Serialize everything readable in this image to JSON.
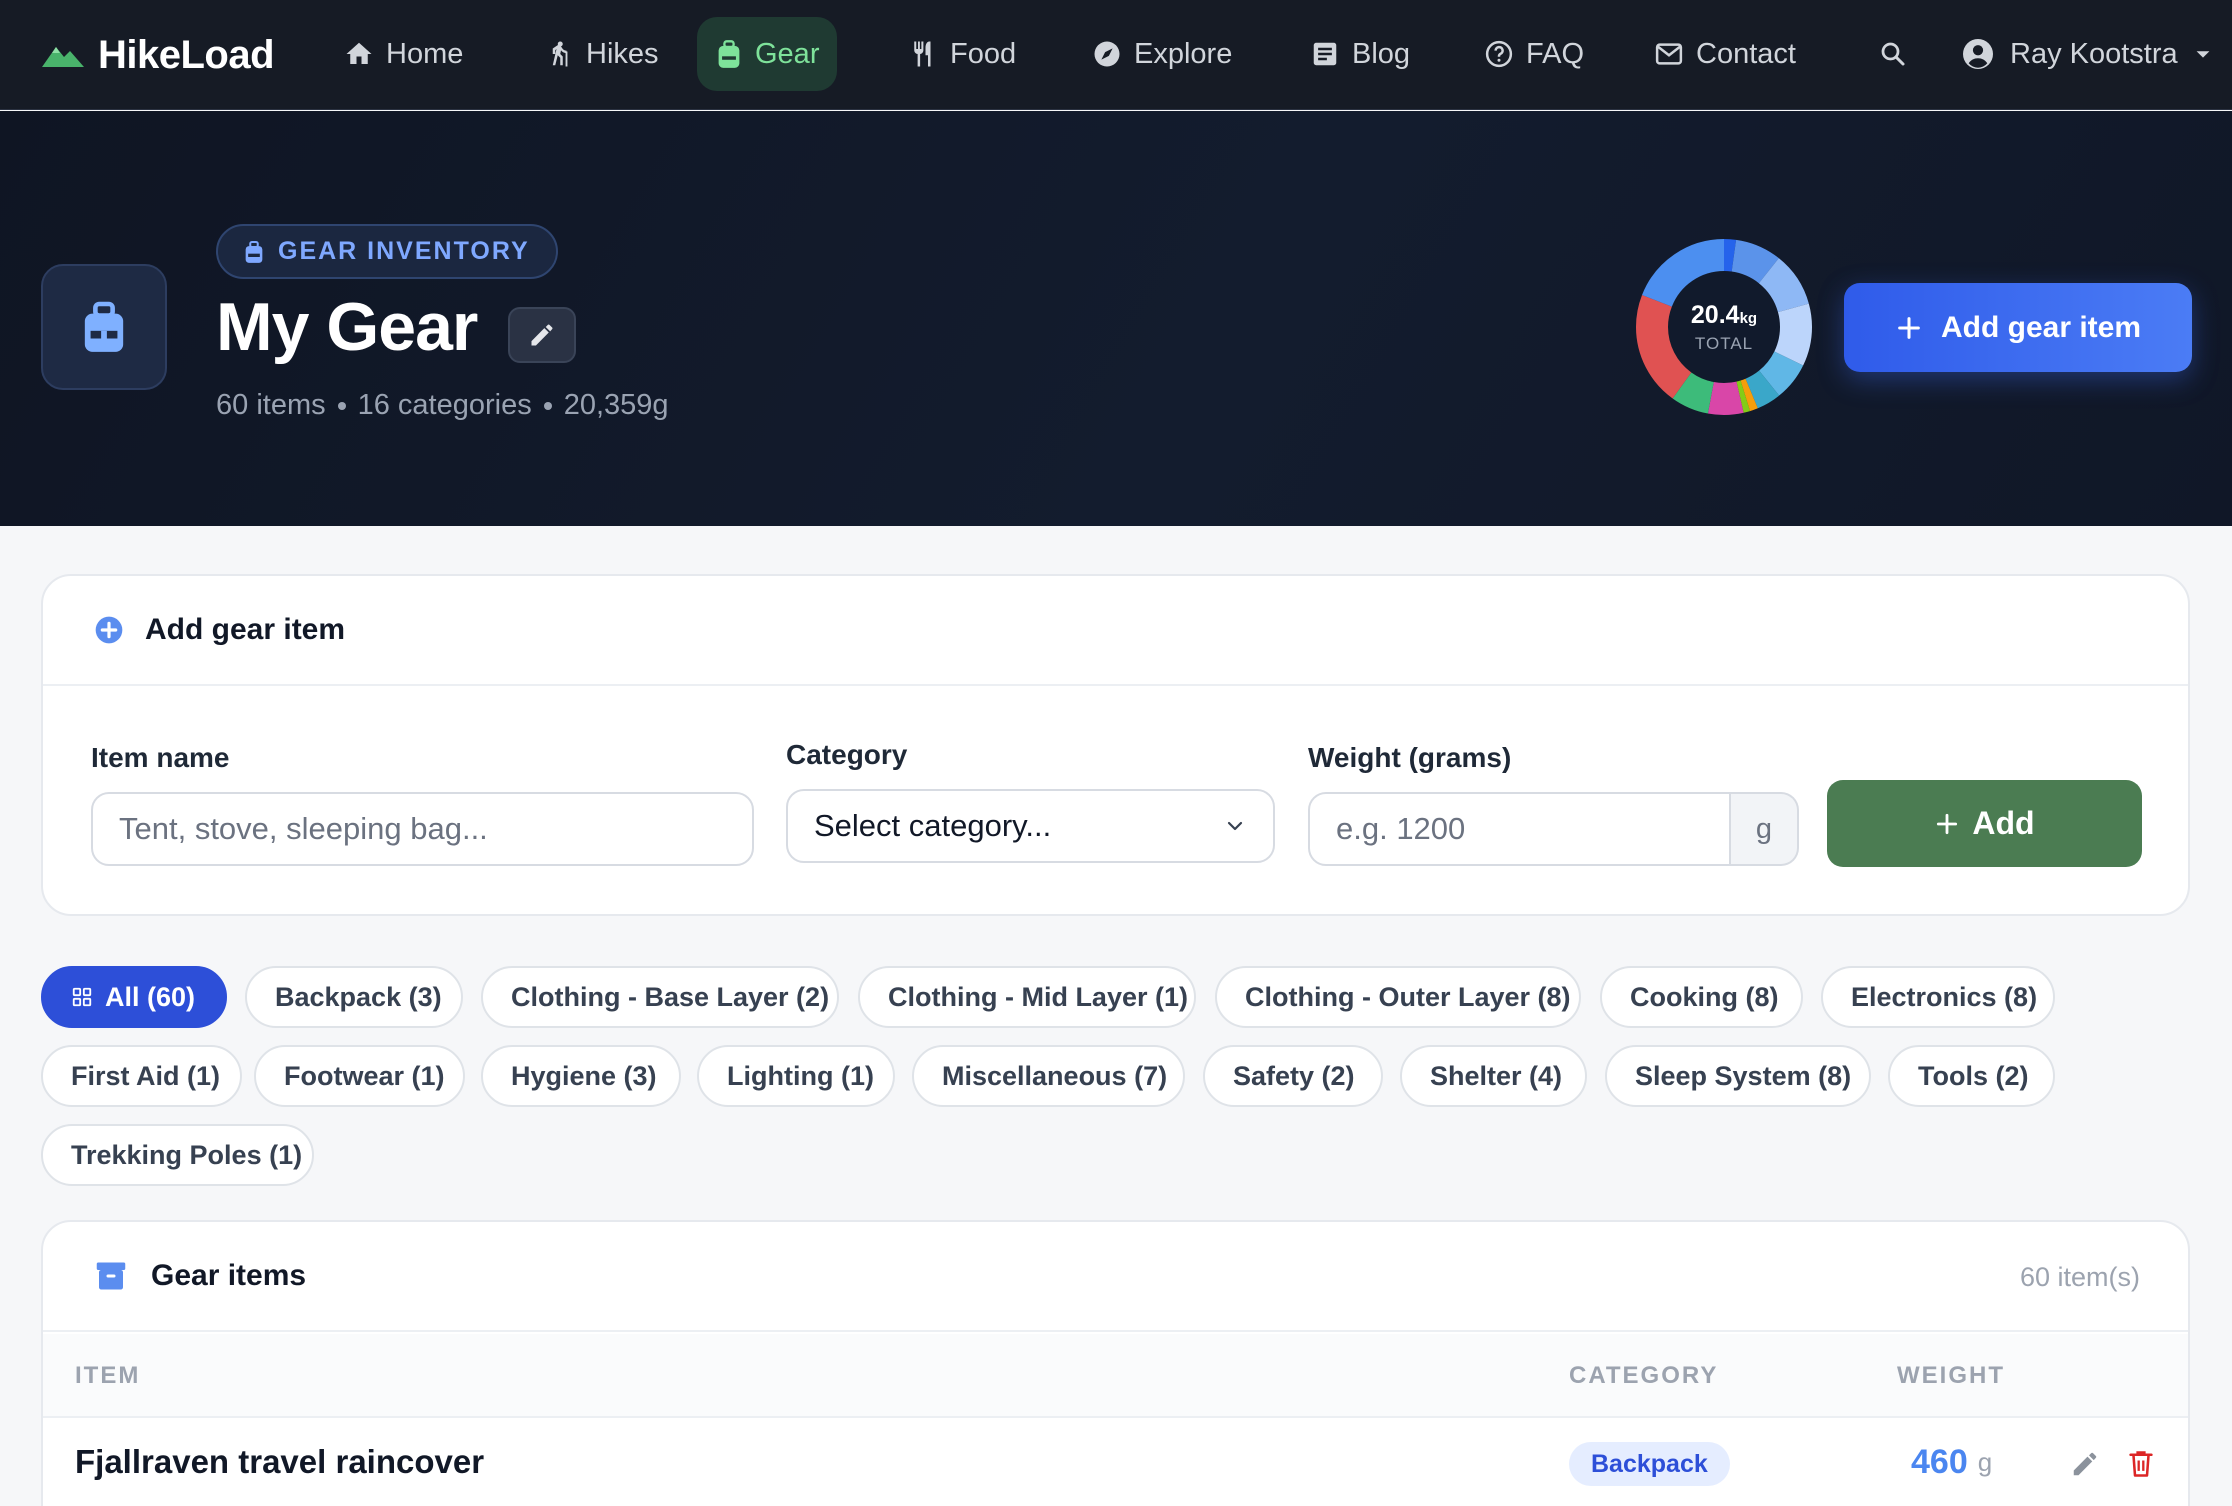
{
  "nav": {
    "brand": "HikeLoad",
    "items": [
      {
        "label": "Home",
        "icon": "home-icon"
      },
      {
        "label": "Hikes",
        "icon": "hiker-icon"
      },
      {
        "label": "Gear",
        "icon": "backpack-icon",
        "active": true
      },
      {
        "label": "Food",
        "icon": "utensils-icon"
      },
      {
        "label": "Explore",
        "icon": "compass-icon"
      },
      {
        "label": "Blog",
        "icon": "article-icon"
      },
      {
        "label": "FAQ",
        "icon": "help-icon"
      },
      {
        "label": "Contact",
        "icon": "mail-icon"
      }
    ],
    "user_name": "Ray Kootstra"
  },
  "hero": {
    "pill_label": "GEAR INVENTORY",
    "title": "My Gear",
    "stats": {
      "items": "60 items",
      "categories": "16 categories",
      "weight": "20,359g"
    },
    "donut": {
      "value": "20.4",
      "unit": "kg",
      "label": "TOTAL",
      "segments": [
        {
          "fraction": 0.022,
          "color": "#2563eb"
        },
        {
          "fraction": 0.085,
          "color": "#5b93ea"
        },
        {
          "fraction": 0.1,
          "color": "#8eb8f5"
        },
        {
          "fraction": 0.115,
          "color": "#bcd5fb"
        },
        {
          "fraction": 0.07,
          "color": "#60b7e6"
        },
        {
          "fraction": 0.045,
          "color": "#3aa7c9"
        },
        {
          "fraction": 0.015,
          "color": "#f59e0b"
        },
        {
          "fraction": 0.012,
          "color": "#84cc16"
        },
        {
          "fraction": 0.065,
          "color": "#d946a8"
        },
        {
          "fraction": 0.07,
          "color": "#3dbb7a"
        },
        {
          "fraction": 0.21,
          "color": "#e05252"
        },
        {
          "fraction": 0.191,
          "color": "#4c8ff0"
        }
      ]
    },
    "add_button": "Add gear item"
  },
  "add_form": {
    "title": "Add gear item",
    "item_name_label": "Item name",
    "item_name_placeholder": "Tent, stove, sleeping bag...",
    "category_label": "Category",
    "category_value": "Select category...",
    "weight_label": "Weight (grams)",
    "weight_placeholder": "e.g. 1200",
    "weight_unit": "g",
    "submit_label": "Add"
  },
  "filters": [
    {
      "label": "All (60)",
      "active": true
    },
    {
      "label": "Backpack (3)"
    },
    {
      "label": "Clothing - Base Layer (2)"
    },
    {
      "label": "Clothing - Mid Layer (1)"
    },
    {
      "label": "Clothing - Outer Layer (8)"
    },
    {
      "label": "Cooking (8)"
    },
    {
      "label": "Electronics (8)"
    },
    {
      "label": "First Aid (1)"
    },
    {
      "label": "Footwear (1)"
    },
    {
      "label": "Hygiene (3)"
    },
    {
      "label": "Lighting (1)"
    },
    {
      "label": "Miscellaneous (7)"
    },
    {
      "label": "Safety (2)"
    },
    {
      "label": "Shelter (4)"
    },
    {
      "label": "Sleep System (8)"
    },
    {
      "label": "Tools (2)"
    },
    {
      "label": "Trekking Poles (1)"
    }
  ],
  "items_table": {
    "title": "Gear items",
    "count": "60 item(s)",
    "columns": {
      "item": "ITEM",
      "category": "CATEGORY",
      "weight": "WEIGHT"
    },
    "rows": [
      {
        "name": "Fjallraven travel raincover",
        "category": "Backpack",
        "weight": "460",
        "unit": "g"
      }
    ]
  }
}
